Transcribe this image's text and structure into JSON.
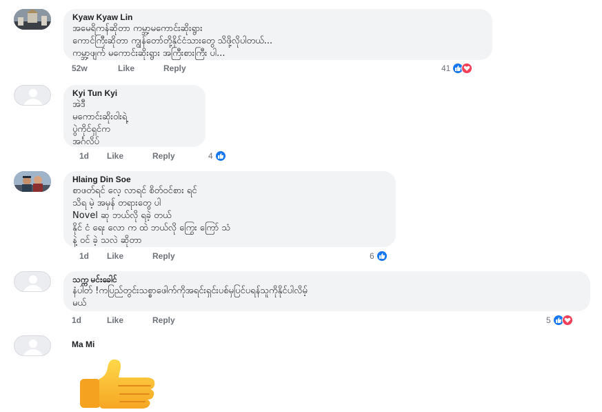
{
  "comments": [
    {
      "author": "Kyaw Kyaw Lin",
      "lines": [
        "အမေရိကန်ဆိုတာ ကမ္ဘာ့မကောင်းဆိုးရွား",
        "ကောင်ကြီးဆိုတာ ကျွန်တော်တို့နိုင်ငံသားတွေ သိဖို့လိုပါတယ်...",
        "ကမ္ဘာ့ဖျက် မကောင်းဆိုးရွား အကြီးစားကြီး ပါ..."
      ],
      "time": "52w",
      "like": "Like",
      "reply": "Reply",
      "reactions": "41"
    },
    {
      "author": "Kyi Tun Kyi",
      "lines": [
        "အဲဒီ",
        "မကောင်းဆိုးဝါးရဲ့",
        "ပွဲကိုင်ရှင်က",
        "အင်္ဂလိပ်"
      ],
      "time": "1d",
      "like": "Like",
      "reply": "Reply",
      "reactions": "4"
    },
    {
      "author": "Hlaing Din Soe",
      "lines": [
        "စာဖတ်ရင် လေ့ လာရင် စိတ်ဝင်စား ရင်",
        "သိရ မဲ့ အမှန် တရားတွေ ပါ",
        "Novel ဆု ဘယ်လို ရခဲ့ တယ်",
        "နိုင် ငံ ရေး လော က ထဲ ဘယ်လို ကြွေး ကြော် သံ",
        "နဲ့ ဝင် ခဲ့ သလဲ ဆိုတာ"
      ],
      "time": "1d",
      "like": "Like",
      "reply": "Reply",
      "reactions": "6"
    },
    {
      "author": "သက္က မင်းခေါင်",
      "lines": [
        "နံပါတ်  !ကပြည်တွင်းသစ္စာဖေါက်ကိုအရင်းရှင်းပစ်မှပြင်ပရန်သူကိုနိုင်ပါလိမ့်",
        "မယ်"
      ],
      "time": "1d",
      "like": "Like",
      "reply": "Reply",
      "reactions": "5"
    },
    {
      "author": "Ma Mi"
    }
  ],
  "icons": {
    "like": "like-reaction-icon",
    "love": "love-reaction-icon",
    "sticker": "thumbs-up-sticker"
  },
  "colors": {
    "bubble": "#f2f3f5",
    "like_blue": "#1877f2",
    "love_red": "#f33e58",
    "meta_gray": "#6d7178"
  }
}
